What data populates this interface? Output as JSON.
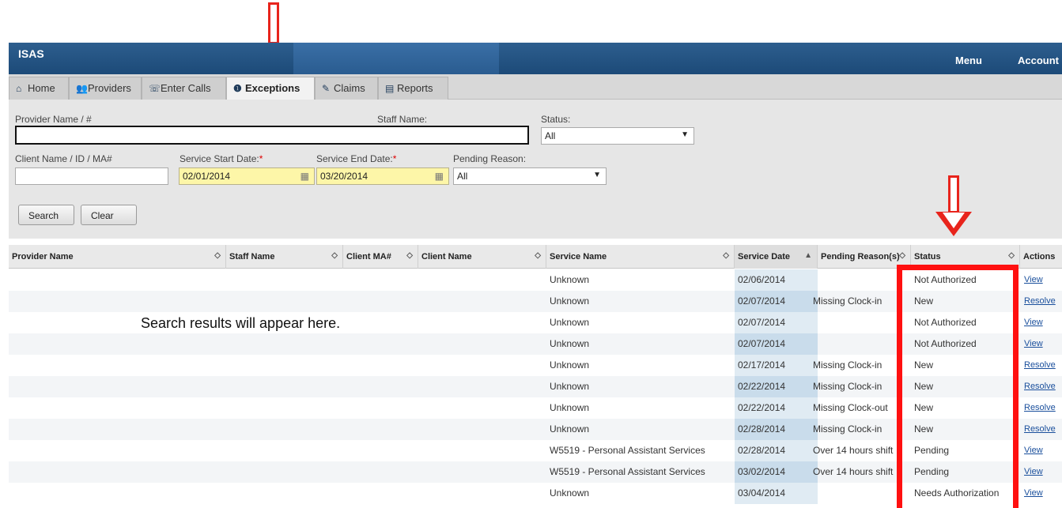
{
  "app_title": "ISAS",
  "top_menu": {
    "menu": "Menu",
    "account": "Account"
  },
  "tabs": [
    {
      "label": "Home",
      "icon": "home-icon"
    },
    {
      "label": "Providers",
      "icon": "users-icon"
    },
    {
      "label": "Enter Calls",
      "icon": "phone-icon"
    },
    {
      "label": "Exceptions",
      "icon": "exclamation-icon",
      "active": true
    },
    {
      "label": "Claims",
      "icon": "edit-icon"
    },
    {
      "label": "Reports",
      "icon": "report-icon"
    }
  ],
  "filters": {
    "provider_label": "Provider Name / #",
    "provider_value": "",
    "staff_label": "Staff Name:",
    "status_label": "Status:",
    "status_value": "All",
    "client_label": "Client Name / ID / MA#",
    "client_value": "",
    "start_label": "Service Start Date:",
    "start_value": "02/01/2014",
    "end_label": "Service End Date:",
    "end_value": "03/20/2014",
    "pending_label": "Pending Reason:",
    "pending_value": "All",
    "required_mark": "*",
    "search_button": "Search",
    "clear_button": "Clear"
  },
  "columns": [
    "Provider Name",
    "Staff Name",
    "Client MA#",
    "Client Name",
    "Service Name",
    "Service Date",
    "Pending Reason(s)",
    "Status",
    "Actions"
  ],
  "placeholder_message": "Search results will appear here.",
  "rows": [
    {
      "service": "Unknown",
      "date": "02/06/2014",
      "reason": "",
      "status": "Not Authorized",
      "action": "View"
    },
    {
      "service": "Unknown",
      "date": "02/07/2014",
      "reason": "Missing Clock-in",
      "status": "New",
      "action": "Resolve"
    },
    {
      "service": "Unknown",
      "date": "02/07/2014",
      "reason": "",
      "status": "Not Authorized",
      "action": "View"
    },
    {
      "service": "Unknown",
      "date": "02/07/2014",
      "reason": "",
      "status": "Not Authorized",
      "action": "View"
    },
    {
      "service": "Unknown",
      "date": "02/17/2014",
      "reason": "Missing Clock-in",
      "status": "New",
      "action": "Resolve"
    },
    {
      "service": "Unknown",
      "date": "02/22/2014",
      "reason": "Missing Clock-in",
      "status": "New",
      "action": "Resolve"
    },
    {
      "service": "Unknown",
      "date": "02/22/2014",
      "reason": "Missing Clock-out",
      "status": "New",
      "action": "Resolve"
    },
    {
      "service": "Unknown",
      "date": "02/28/2014",
      "reason": "Missing Clock-in",
      "status": "New",
      "action": "Resolve"
    },
    {
      "service": "W5519 - Personal Assistant Services",
      "date": "02/28/2014",
      "reason": "Over 14 hours shift",
      "status": "Pending",
      "action": "View"
    },
    {
      "service": "W5519 - Personal Assistant Services",
      "date": "03/02/2014",
      "reason": "Over 14 hours shift",
      "status": "Pending",
      "action": "View"
    },
    {
      "service": "Unknown",
      "date": "03/04/2014",
      "reason": "",
      "status": "Needs Authorization",
      "action": "View"
    }
  ],
  "colors": {
    "header_blue": "#1c4a78",
    "date_highlight": "#fdf6a8",
    "annotation_red": "#ff1010",
    "link_blue": "#1a4f9c"
  }
}
